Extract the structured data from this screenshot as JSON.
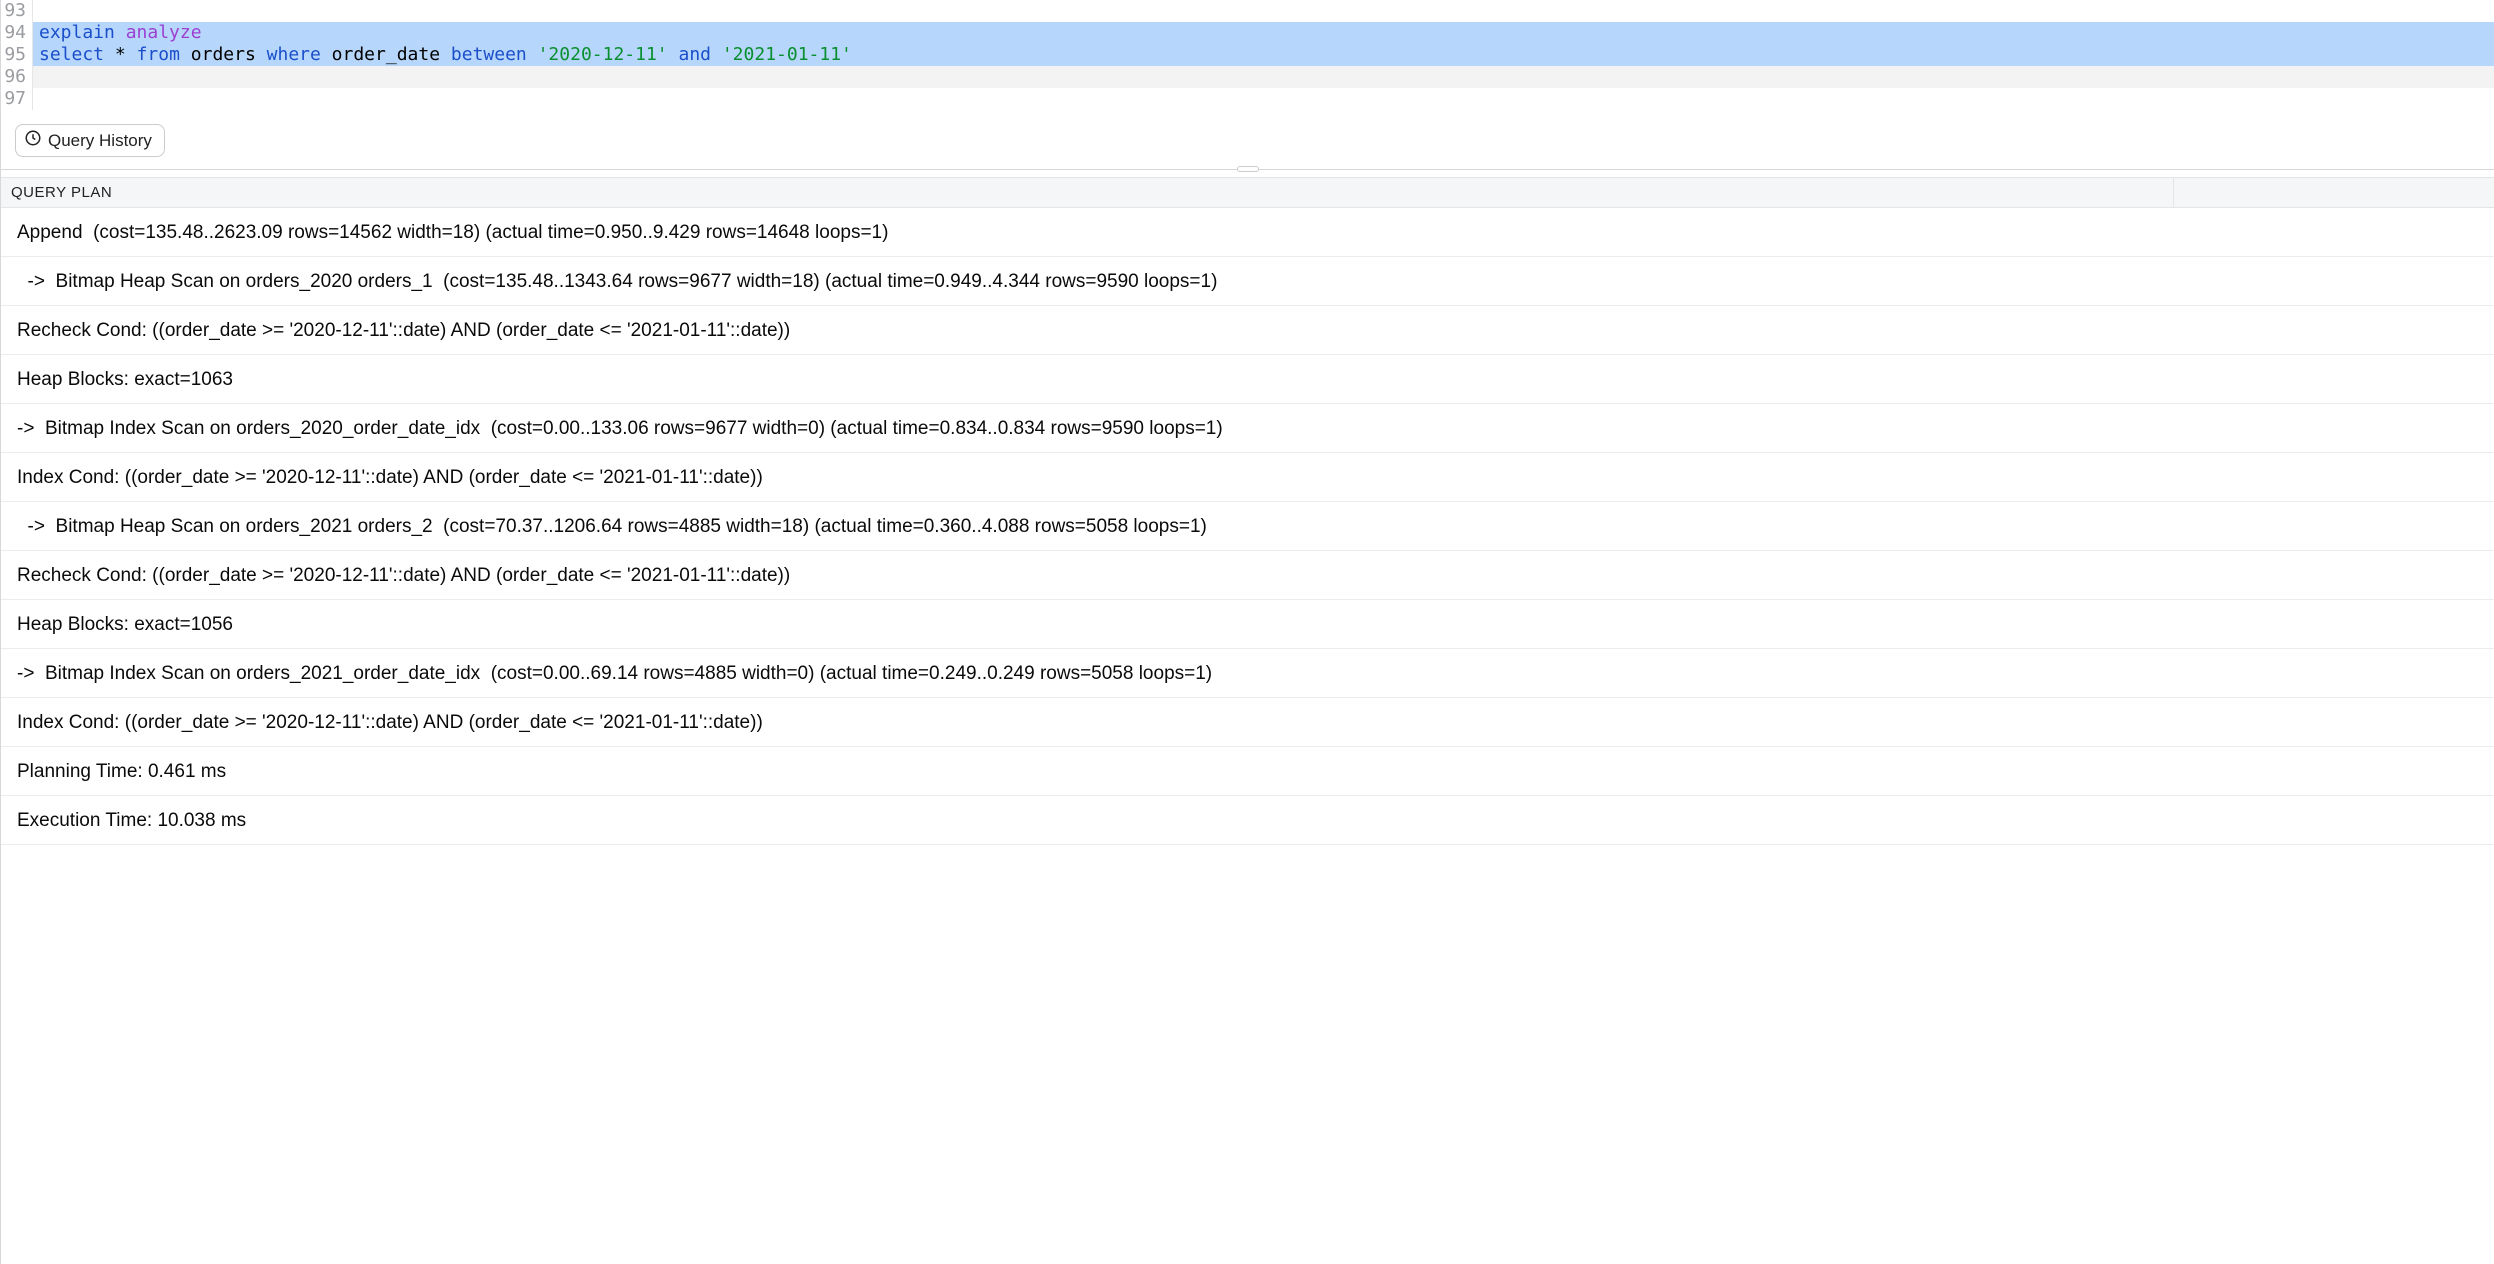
{
  "editor": {
    "gutter": [
      "93",
      "94",
      "95",
      "96",
      "97"
    ],
    "tokens": {
      "explain": "explain",
      "analyze": "analyze",
      "select": "select",
      "star": "*",
      "from": "from",
      "orders": "orders",
      "where": "where",
      "order_date": "order_date",
      "between": "between",
      "date1": "'2020-12-11'",
      "and": "and",
      "date2": "'2021-01-11'"
    }
  },
  "toolbar": {
    "query_history_label": "Query History"
  },
  "results": {
    "header": "QUERY PLAN",
    "rows": [
      {
        "indent": 1,
        "text": "Append  (cost=135.48..2623.09 rows=14562 width=18) (actual time=0.950..9.429 rows=14648 loops=1)"
      },
      {
        "indent": 1,
        "text": "  ->  Bitmap Heap Scan on orders_2020 orders_1  (cost=135.48..1343.64 rows=9677 width=18) (actual time=0.949..4.344 rows=9590 loops=1)"
      },
      {
        "indent": 2,
        "text": "Recheck Cond: ((order_date >= '2020-12-11'::date) AND (order_date <= '2021-01-11'::date))"
      },
      {
        "indent": 2,
        "text": "Heap Blocks: exact=1063"
      },
      {
        "indent": 2,
        "text": "->  Bitmap Index Scan on orders_2020_order_date_idx  (cost=0.00..133.06 rows=9677 width=0) (actual time=0.834..0.834 rows=9590 loops=1)"
      },
      {
        "indent": 3,
        "text": "Index Cond: ((order_date >= '2020-12-11'::date) AND (order_date <= '2021-01-11'::date))"
      },
      {
        "indent": 1,
        "text": "  ->  Bitmap Heap Scan on orders_2021 orders_2  (cost=70.37..1206.64 rows=4885 width=18) (actual time=0.360..4.088 rows=5058 loops=1)"
      },
      {
        "indent": 2,
        "text": "Recheck Cond: ((order_date >= '2020-12-11'::date) AND (order_date <= '2021-01-11'::date))"
      },
      {
        "indent": 2,
        "text": "Heap Blocks: exact=1056"
      },
      {
        "indent": 2,
        "text": "->  Bitmap Index Scan on orders_2021_order_date_idx  (cost=0.00..69.14 rows=4885 width=0) (actual time=0.249..0.249 rows=5058 loops=1)"
      },
      {
        "indent": 3,
        "text": "Index Cond: ((order_date >= '2020-12-11'::date) AND (order_date <= '2021-01-11'::date))"
      },
      {
        "indent": 1,
        "text": "Planning Time: 0.461 ms"
      },
      {
        "indent": 1,
        "text": "Execution Time: 10.038 ms"
      }
    ]
  }
}
